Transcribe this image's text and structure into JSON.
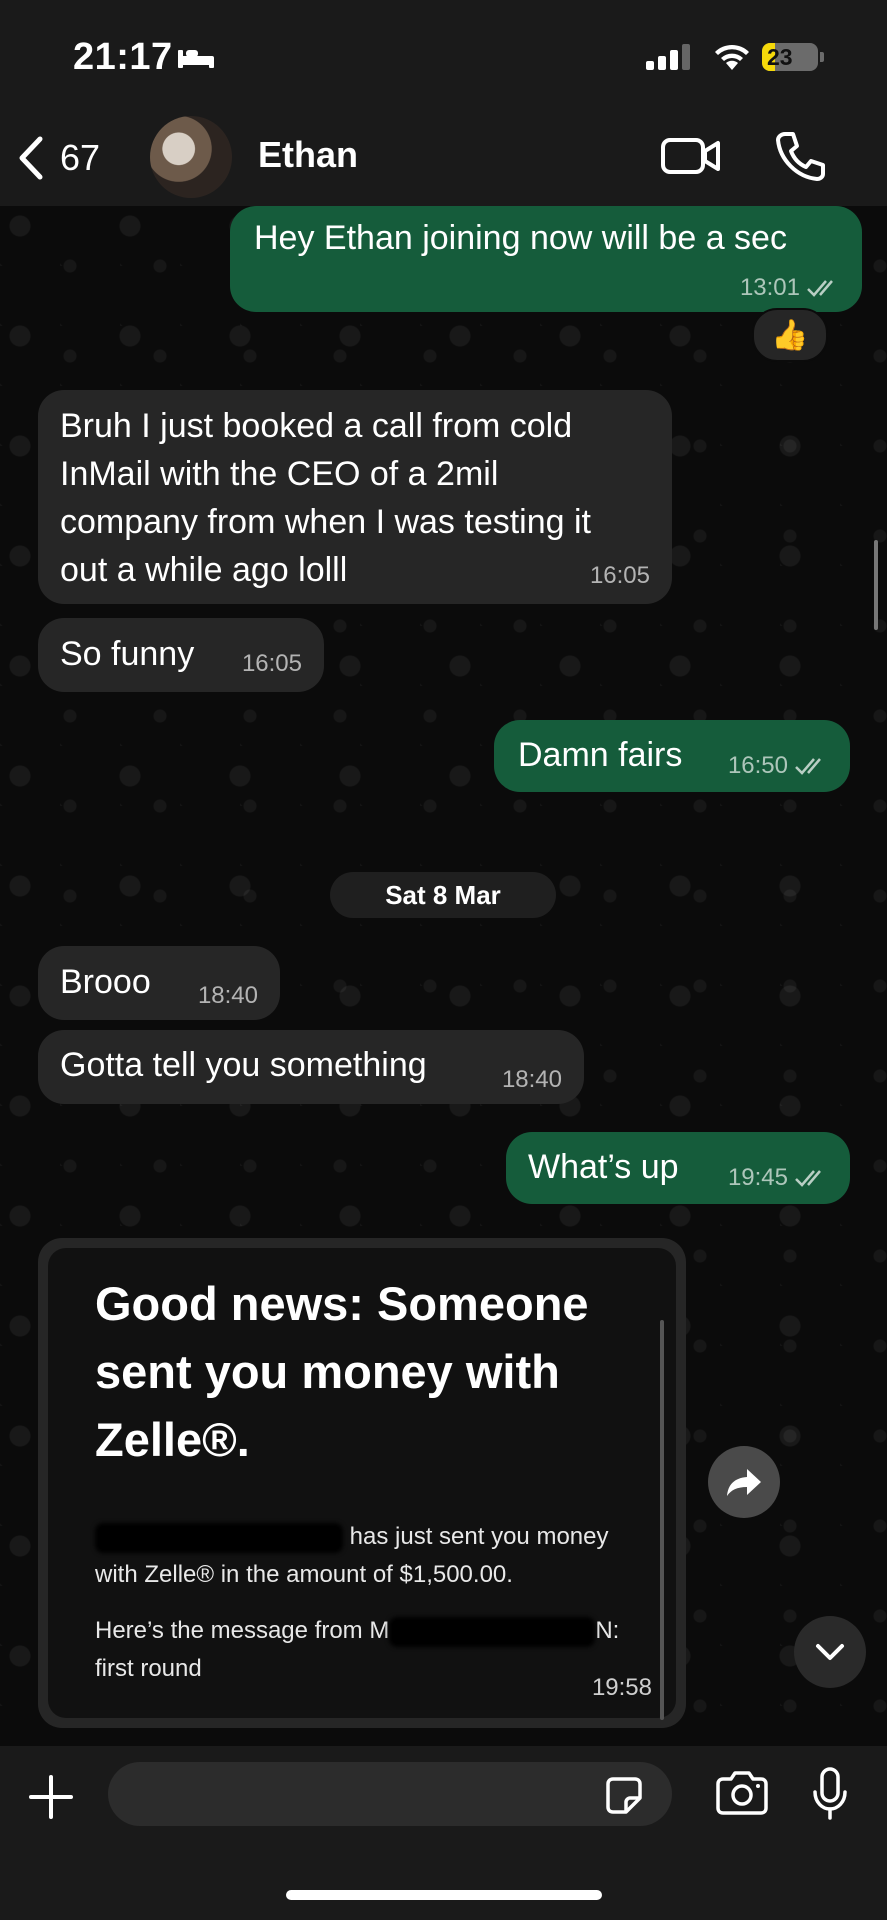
{
  "status_bar": {
    "time": "21:17",
    "battery": "23",
    "battery_level": 0.23
  },
  "header": {
    "back_count": "67",
    "contact_name": "Ethan"
  },
  "messages": [
    {
      "text": "Hey Ethan joining now will be a sec",
      "time": "13:01",
      "direction": "out",
      "read": true
    },
    {
      "text": "Bruh I just booked a call from cold\nInMail with the CEO of a 2mil\ncompany from when I was testing it\nout a while ago lolll",
      "time": "16:05",
      "direction": "in"
    },
    {
      "text": "So funny",
      "time": "16:05",
      "direction": "in"
    },
    {
      "text": "Damn fairs",
      "time": "16:50",
      "direction": "out",
      "read": true
    },
    {
      "text": "Brooo",
      "time": "18:40",
      "direction": "in"
    },
    {
      "text": "Gotta tell you something",
      "time": "18:40",
      "direction": "in"
    },
    {
      "text": "What’s up",
      "time": "19:45",
      "direction": "out",
      "read": true
    }
  ],
  "reaction": {
    "emoji": "👍"
  },
  "date_separator": "Sat 8 Mar",
  "zelle_card": {
    "title": "Good news: Someone sent you money with Zelle®.",
    "line1": "has just sent you money",
    "line2": "with Zelle® in the amount of $1,500.00.",
    "line3_prefix": "Here’s the message from M",
    "line3_suffix": "N:",
    "line4": "first round",
    "time": "19:58"
  },
  "input": {
    "placeholder": ""
  },
  "colors": {
    "outgoing": "#155c3b",
    "incoming": "#262626",
    "background": "#0b0b0b",
    "bar": "#1a1a1a"
  }
}
